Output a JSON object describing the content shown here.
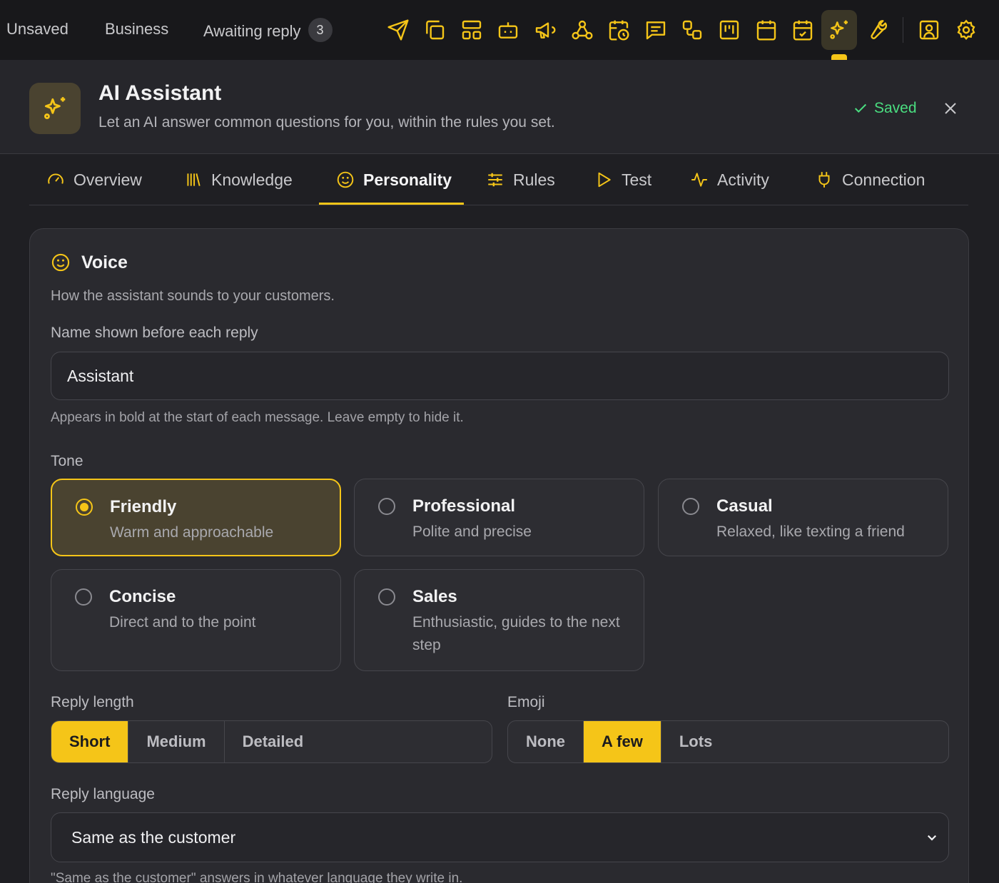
{
  "topbar": {
    "filters": [
      {
        "label": "Unsaved"
      },
      {
        "label": "Business"
      },
      {
        "label": "Awaiting reply",
        "count": "3"
      }
    ],
    "tools": [
      "send-icon",
      "copy-icon",
      "layout-icon",
      "bot-icon",
      "megaphone-icon",
      "webhook-icon",
      "calendar-clock-icon",
      "message-square-icon",
      "workflow-icon",
      "kanban-icon",
      "calendar-grid-icon",
      "calendar-check-icon",
      "sparkles-icon",
      "wrench-icon",
      "contact-icon",
      "settings-icon"
    ],
    "active_tool": "sparkles-icon",
    "accent": "#f5c518"
  },
  "header": {
    "title": "AI Assistant",
    "subtitle": "Let an AI answer common questions for you, within the rules you set.",
    "status": "Saved",
    "status_color": "#4ade80"
  },
  "tabs": [
    {
      "label": "Overview",
      "icon": "gauge-icon"
    },
    {
      "label": "Knowledge",
      "icon": "library-icon"
    },
    {
      "label": "Personality",
      "icon": "smile-icon",
      "active": true
    },
    {
      "label": "Rules",
      "icon": "sliders-icon"
    },
    {
      "label": "Test",
      "icon": "play-icon"
    },
    {
      "label": "Activity",
      "icon": "activity-icon"
    },
    {
      "label": "Connection",
      "icon": "plug-icon"
    }
  ],
  "voice": {
    "title": "Voice",
    "description": "How the assistant sounds to your customers.",
    "name_label": "Name shown before each reply",
    "name_value": "Assistant",
    "name_hint": "Appears in bold at the start of each message. Leave empty to hide it.",
    "tone_label": "Tone",
    "tones": [
      {
        "name": "Friendly",
        "desc": "Warm and approachable",
        "selected": true
      },
      {
        "name": "Professional",
        "desc": "Polite and precise"
      },
      {
        "name": "Casual",
        "desc": "Relaxed, like texting a friend"
      },
      {
        "name": "Concise",
        "desc": "Direct and to the point"
      },
      {
        "name": "Sales",
        "desc": "Enthusiastic, guides to the next step"
      }
    ],
    "reply_length_label": "Reply length",
    "reply_length_options": [
      "Short",
      "Medium",
      "Detailed"
    ],
    "reply_length_selected": "Short",
    "emoji_label": "Emoji",
    "emoji_options": [
      "None",
      "A few",
      "Lots"
    ],
    "emoji_selected": "A few",
    "language_label": "Reply language",
    "language_value": "Same as the customer",
    "language_hint": "\"Same as the customer\" answers in whatever language they write in."
  }
}
